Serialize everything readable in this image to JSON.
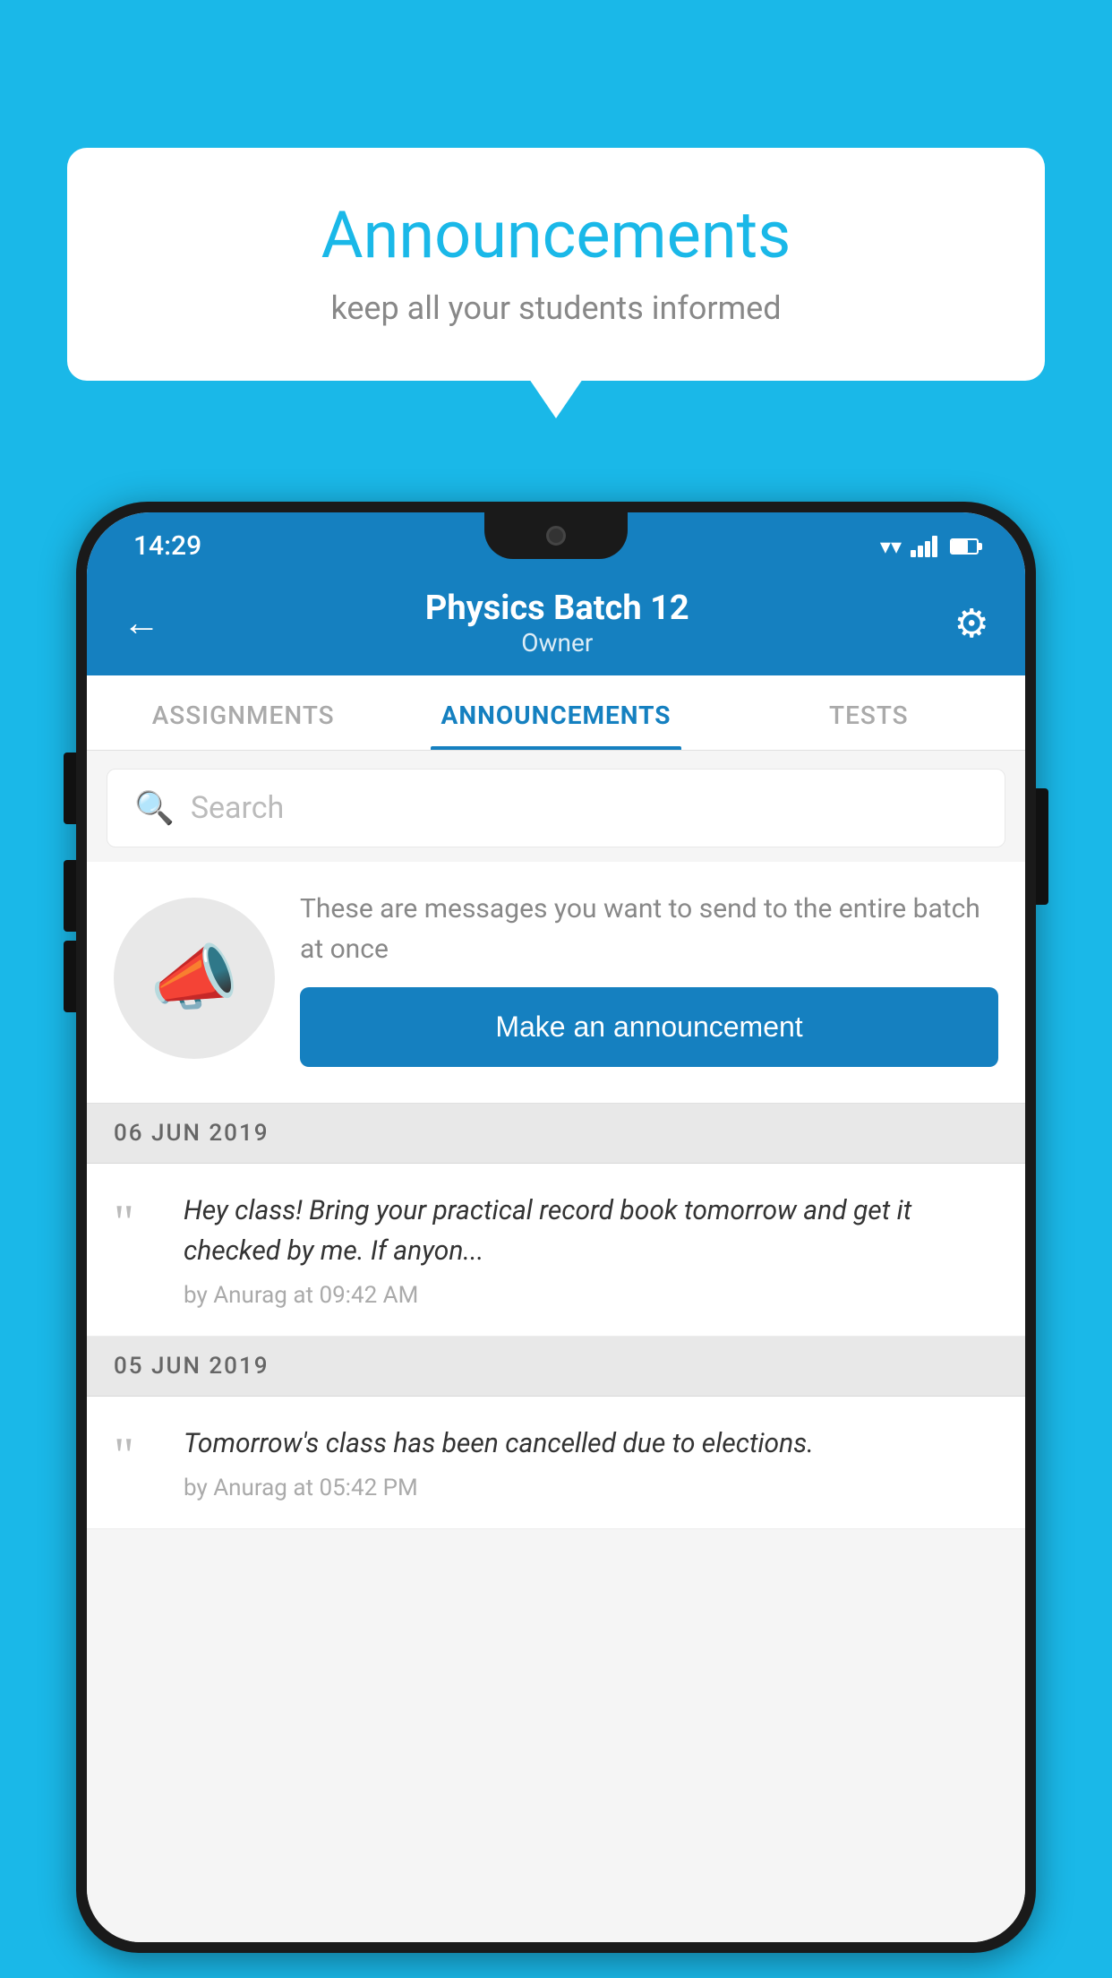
{
  "bubble": {
    "title": "Announcements",
    "subtitle": "keep all your students informed"
  },
  "phone": {
    "status_bar": {
      "time": "14:29"
    },
    "header": {
      "title": "Physics Batch 12",
      "subtitle": "Owner",
      "back_label": "←",
      "settings_label": "⚙"
    },
    "tabs": [
      {
        "label": "ASSIGNMENTS",
        "active": false
      },
      {
        "label": "ANNOUNCEMENTS",
        "active": true
      },
      {
        "label": "TESTS",
        "active": false
      }
    ],
    "search": {
      "placeholder": "Search"
    },
    "promo": {
      "description": "These are messages you want to send to the entire batch at once",
      "button_label": "Make an announcement"
    },
    "date_groups": [
      {
        "date": "06  JUN  2019",
        "announcements": [
          {
            "text": "Hey class! Bring your practical record book tomorrow and get it checked by me. If anyon...",
            "meta": "by Anurag at 09:42 AM"
          }
        ]
      },
      {
        "date": "05  JUN  2019",
        "announcements": [
          {
            "text": "Tomorrow's class has been cancelled due to elections.",
            "meta": "by Anurag at 05:42 PM"
          }
        ]
      }
    ]
  }
}
